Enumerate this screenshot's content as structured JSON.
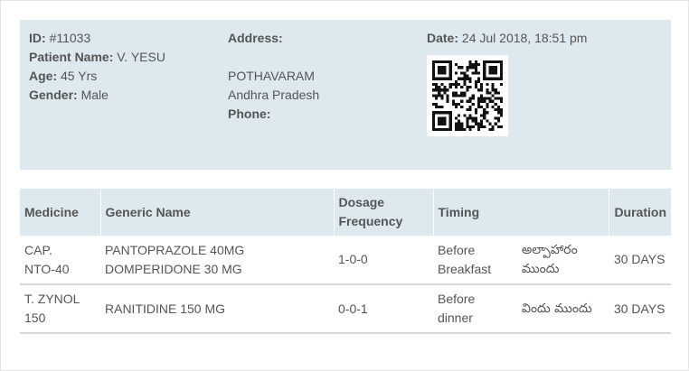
{
  "patient": {
    "id_label": "ID:",
    "id_value": "#11033",
    "name_label": "Patient Name:",
    "name_value": "V. YESU",
    "age_label": "Age:",
    "age_value": "45 Yrs",
    "gender_label": "Gender:",
    "gender_value": "Male",
    "address_label": "Address:",
    "address_line1": "POTHAVARAM",
    "address_line2": "Andhra Pradesh",
    "phone_label": "Phone:",
    "phone_value": "",
    "date_label": "Date:",
    "date_value": "24 Jul 2018, 18:51 pm",
    "qr_icon": "qr-code-icon"
  },
  "table": {
    "headers": {
      "medicine": "Medicine",
      "generic": "Generic Name",
      "dosage_line1": "Dosage",
      "dosage_line2": "Frequency",
      "timing": "Timing",
      "duration": "Duration"
    },
    "rows": [
      {
        "medicine_line1": "CAP.",
        "medicine_line2": "NTO-40",
        "generic_line1": "PANTOPRAZOLE 40MG",
        "generic_line2": "DOMPERIDONE 30 MG",
        "dosage": "1-0-0",
        "timing_line1": "Before",
        "timing_line2": "Breakfast",
        "timing_local_line1": "అల్పాహారం",
        "timing_local_line2": "ముందు",
        "duration": "30 DAYS"
      },
      {
        "medicine_line1": "T. ZYNOL",
        "medicine_line2": "150",
        "generic_line1": "RANITIDINE 150 MG",
        "generic_line2": "",
        "dosage": "0-0-1",
        "timing_line1": "Before",
        "timing_line2": "dinner",
        "timing_local_line1": "విందు ముందు",
        "timing_local_line2": "",
        "duration": "30 DAYS"
      }
    ]
  }
}
